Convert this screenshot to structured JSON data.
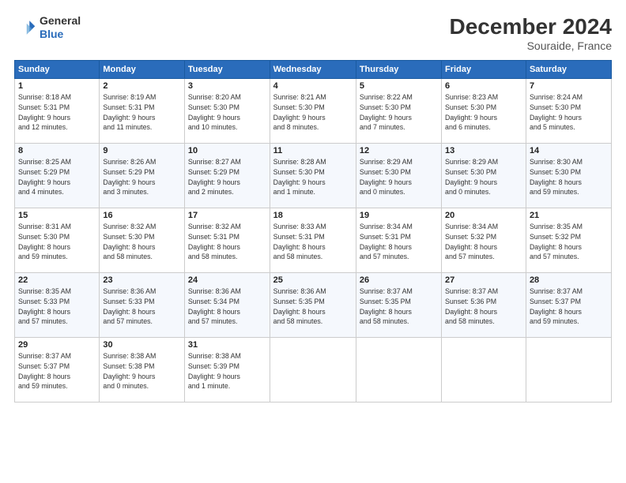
{
  "header": {
    "logo_line1": "General",
    "logo_line2": "Blue",
    "title": "December 2024",
    "subtitle": "Souraide, France"
  },
  "columns": [
    "Sunday",
    "Monday",
    "Tuesday",
    "Wednesday",
    "Thursday",
    "Friday",
    "Saturday"
  ],
  "weeks": [
    [
      {
        "day": "1",
        "info": "Sunrise: 8:18 AM\nSunset: 5:31 PM\nDaylight: 9 hours\nand 12 minutes."
      },
      {
        "day": "2",
        "info": "Sunrise: 8:19 AM\nSunset: 5:31 PM\nDaylight: 9 hours\nand 11 minutes."
      },
      {
        "day": "3",
        "info": "Sunrise: 8:20 AM\nSunset: 5:30 PM\nDaylight: 9 hours\nand 10 minutes."
      },
      {
        "day": "4",
        "info": "Sunrise: 8:21 AM\nSunset: 5:30 PM\nDaylight: 9 hours\nand 8 minutes."
      },
      {
        "day": "5",
        "info": "Sunrise: 8:22 AM\nSunset: 5:30 PM\nDaylight: 9 hours\nand 7 minutes."
      },
      {
        "day": "6",
        "info": "Sunrise: 8:23 AM\nSunset: 5:30 PM\nDaylight: 9 hours\nand 6 minutes."
      },
      {
        "day": "7",
        "info": "Sunrise: 8:24 AM\nSunset: 5:30 PM\nDaylight: 9 hours\nand 5 minutes."
      }
    ],
    [
      {
        "day": "8",
        "info": "Sunrise: 8:25 AM\nSunset: 5:29 PM\nDaylight: 9 hours\nand 4 minutes."
      },
      {
        "day": "9",
        "info": "Sunrise: 8:26 AM\nSunset: 5:29 PM\nDaylight: 9 hours\nand 3 minutes."
      },
      {
        "day": "10",
        "info": "Sunrise: 8:27 AM\nSunset: 5:29 PM\nDaylight: 9 hours\nand 2 minutes."
      },
      {
        "day": "11",
        "info": "Sunrise: 8:28 AM\nSunset: 5:30 PM\nDaylight: 9 hours\nand 1 minute."
      },
      {
        "day": "12",
        "info": "Sunrise: 8:29 AM\nSunset: 5:30 PM\nDaylight: 9 hours\nand 0 minutes."
      },
      {
        "day": "13",
        "info": "Sunrise: 8:29 AM\nSunset: 5:30 PM\nDaylight: 9 hours\nand 0 minutes."
      },
      {
        "day": "14",
        "info": "Sunrise: 8:30 AM\nSunset: 5:30 PM\nDaylight: 8 hours\nand 59 minutes."
      }
    ],
    [
      {
        "day": "15",
        "info": "Sunrise: 8:31 AM\nSunset: 5:30 PM\nDaylight: 8 hours\nand 59 minutes."
      },
      {
        "day": "16",
        "info": "Sunrise: 8:32 AM\nSunset: 5:30 PM\nDaylight: 8 hours\nand 58 minutes."
      },
      {
        "day": "17",
        "info": "Sunrise: 8:32 AM\nSunset: 5:31 PM\nDaylight: 8 hours\nand 58 minutes."
      },
      {
        "day": "18",
        "info": "Sunrise: 8:33 AM\nSunset: 5:31 PM\nDaylight: 8 hours\nand 58 minutes."
      },
      {
        "day": "19",
        "info": "Sunrise: 8:34 AM\nSunset: 5:31 PM\nDaylight: 8 hours\nand 57 minutes."
      },
      {
        "day": "20",
        "info": "Sunrise: 8:34 AM\nSunset: 5:32 PM\nDaylight: 8 hours\nand 57 minutes."
      },
      {
        "day": "21",
        "info": "Sunrise: 8:35 AM\nSunset: 5:32 PM\nDaylight: 8 hours\nand 57 minutes."
      }
    ],
    [
      {
        "day": "22",
        "info": "Sunrise: 8:35 AM\nSunset: 5:33 PM\nDaylight: 8 hours\nand 57 minutes."
      },
      {
        "day": "23",
        "info": "Sunrise: 8:36 AM\nSunset: 5:33 PM\nDaylight: 8 hours\nand 57 minutes."
      },
      {
        "day": "24",
        "info": "Sunrise: 8:36 AM\nSunset: 5:34 PM\nDaylight: 8 hours\nand 57 minutes."
      },
      {
        "day": "25",
        "info": "Sunrise: 8:36 AM\nSunset: 5:35 PM\nDaylight: 8 hours\nand 58 minutes."
      },
      {
        "day": "26",
        "info": "Sunrise: 8:37 AM\nSunset: 5:35 PM\nDaylight: 8 hours\nand 58 minutes."
      },
      {
        "day": "27",
        "info": "Sunrise: 8:37 AM\nSunset: 5:36 PM\nDaylight: 8 hours\nand 58 minutes."
      },
      {
        "day": "28",
        "info": "Sunrise: 8:37 AM\nSunset: 5:37 PM\nDaylight: 8 hours\nand 59 minutes."
      }
    ],
    [
      {
        "day": "29",
        "info": "Sunrise: 8:37 AM\nSunset: 5:37 PM\nDaylight: 8 hours\nand 59 minutes."
      },
      {
        "day": "30",
        "info": "Sunrise: 8:38 AM\nSunset: 5:38 PM\nDaylight: 9 hours\nand 0 minutes."
      },
      {
        "day": "31",
        "info": "Sunrise: 8:38 AM\nSunset: 5:39 PM\nDaylight: 9 hours\nand 1 minute."
      },
      null,
      null,
      null,
      null
    ]
  ]
}
